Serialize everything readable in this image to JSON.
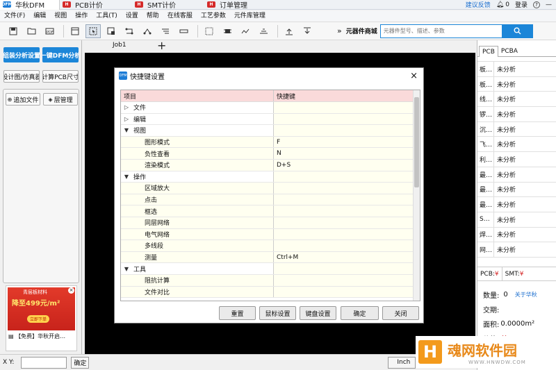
{
  "tabs": [
    {
      "label": "华秋DFM",
      "logo": "DFM",
      "color": "#1c7cd6"
    },
    {
      "label": "PCB计价",
      "logo": "H",
      "color": "#d52b2b"
    },
    {
      "label": "SMT计价",
      "logo": "H",
      "color": "#d52b2b"
    },
    {
      "label": "订单管理",
      "logo": "H",
      "color": "#d52b2b"
    }
  ],
  "topright": {
    "feedback": "建议反馈",
    "notify_count": "0",
    "login": "登录"
  },
  "menu": [
    "文件(F)",
    "编辑",
    "视图",
    "操作",
    "工具(T)",
    "设置",
    "帮助",
    "在线客服",
    "工艺参数",
    "元件库管理"
  ],
  "store": {
    "label": "元器件商城",
    "search_placeholder": "元器件型号、描述、参数",
    "more": "»"
  },
  "left": {
    "btn_assembly": "组装分析设置",
    "btn_dfm": "一键DFM分析",
    "btn_design": "设计图/仿真器",
    "btn_calc": "计算PCB尺寸",
    "btn_add_file": "追加文件",
    "btn_layer": "层管理",
    "ad_line1": "青层板材料",
    "ad_line2": "降至499元/m²",
    "ad_line3": "立即下单",
    "ad_caption": "【免费】华秋开启…"
  },
  "job_tab": "Job1",
  "plus": "+",
  "right": {
    "tab_pcb": "PCB",
    "tab_pcba": "PCBA",
    "rows": [
      {
        "k": "板…",
        "v": "未分析"
      },
      {
        "k": "板…",
        "v": "未分析"
      },
      {
        "k": "线…",
        "v": "未分析"
      },
      {
        "k": "锣…",
        "v": "未分析"
      },
      {
        "k": "沉…",
        "v": "未分析"
      },
      {
        "k": "飞…",
        "v": "未分析"
      },
      {
        "k": "利…",
        "v": "未分析"
      },
      {
        "k": "最…",
        "v": "未分析"
      },
      {
        "k": "最…",
        "v": "未分析"
      },
      {
        "k": "最…",
        "v": "未分析"
      },
      {
        "k": "S…",
        "v": "未分析"
      },
      {
        "k": "焊…",
        "v": "未分析"
      },
      {
        "k": "网…",
        "v": "未分析"
      }
    ],
    "price_pcb": "PCB:",
    "price_pcb_val": "¥",
    "price_smt": "SMT:",
    "price_smt_val": "¥",
    "qty_label": "数量:",
    "qty_val": "0",
    "about": "关于华秋",
    "delivery_label": "交期:",
    "area_label": "面积:",
    "area_val": "0.0000m²",
    "price_label": "价格:",
    "price_val": "¥"
  },
  "bottom": {
    "xy_label": "X Y:",
    "confirm": "确定",
    "unit": "Inch"
  },
  "dialog": {
    "title": "快捷键设置",
    "col_item": "项目",
    "col_key": "快捷键",
    "rows": [
      {
        "level": 0,
        "arrow": "▷",
        "name": "文件",
        "key": ""
      },
      {
        "level": 0,
        "arrow": "▷",
        "name": "编辑",
        "key": ""
      },
      {
        "level": 0,
        "arrow": "▼",
        "name": "视图",
        "key": ""
      },
      {
        "level": 1,
        "arrow": "",
        "name": "图形模式",
        "key": "F"
      },
      {
        "level": 1,
        "arrow": "",
        "name": "负性查看",
        "key": "N"
      },
      {
        "level": 1,
        "arrow": "",
        "name": "渲染模式",
        "key": "D+S"
      },
      {
        "level": 0,
        "arrow": "▼",
        "name": "操作",
        "key": ""
      },
      {
        "level": 1,
        "arrow": "",
        "name": "区域放大",
        "key": ""
      },
      {
        "level": 1,
        "arrow": "",
        "name": "点击",
        "key": ""
      },
      {
        "level": 1,
        "arrow": "",
        "name": "框选",
        "key": ""
      },
      {
        "level": 1,
        "arrow": "",
        "name": "同层网络",
        "key": ""
      },
      {
        "level": 1,
        "arrow": "",
        "name": "电气网络",
        "key": ""
      },
      {
        "level": 1,
        "arrow": "",
        "name": "多线段",
        "key": ""
      },
      {
        "level": 1,
        "arrow": "",
        "name": "测量",
        "key": "Ctrl+M"
      },
      {
        "level": 0,
        "arrow": "▼",
        "name": "工具",
        "key": ""
      },
      {
        "level": 1,
        "arrow": "",
        "name": "阻抗计算",
        "key": ""
      },
      {
        "level": 1,
        "arrow": "",
        "name": "文件对比",
        "key": ""
      }
    ],
    "btn_reset": "重置",
    "btn_mouse": "鼠标设置",
    "btn_keyboard": "键盘设置",
    "btn_ok": "确定",
    "btn_close": "关闭"
  },
  "watermark": {
    "title": "魂网软件园",
    "url": "WWW.HNWDW.COM",
    "logo": "H"
  }
}
